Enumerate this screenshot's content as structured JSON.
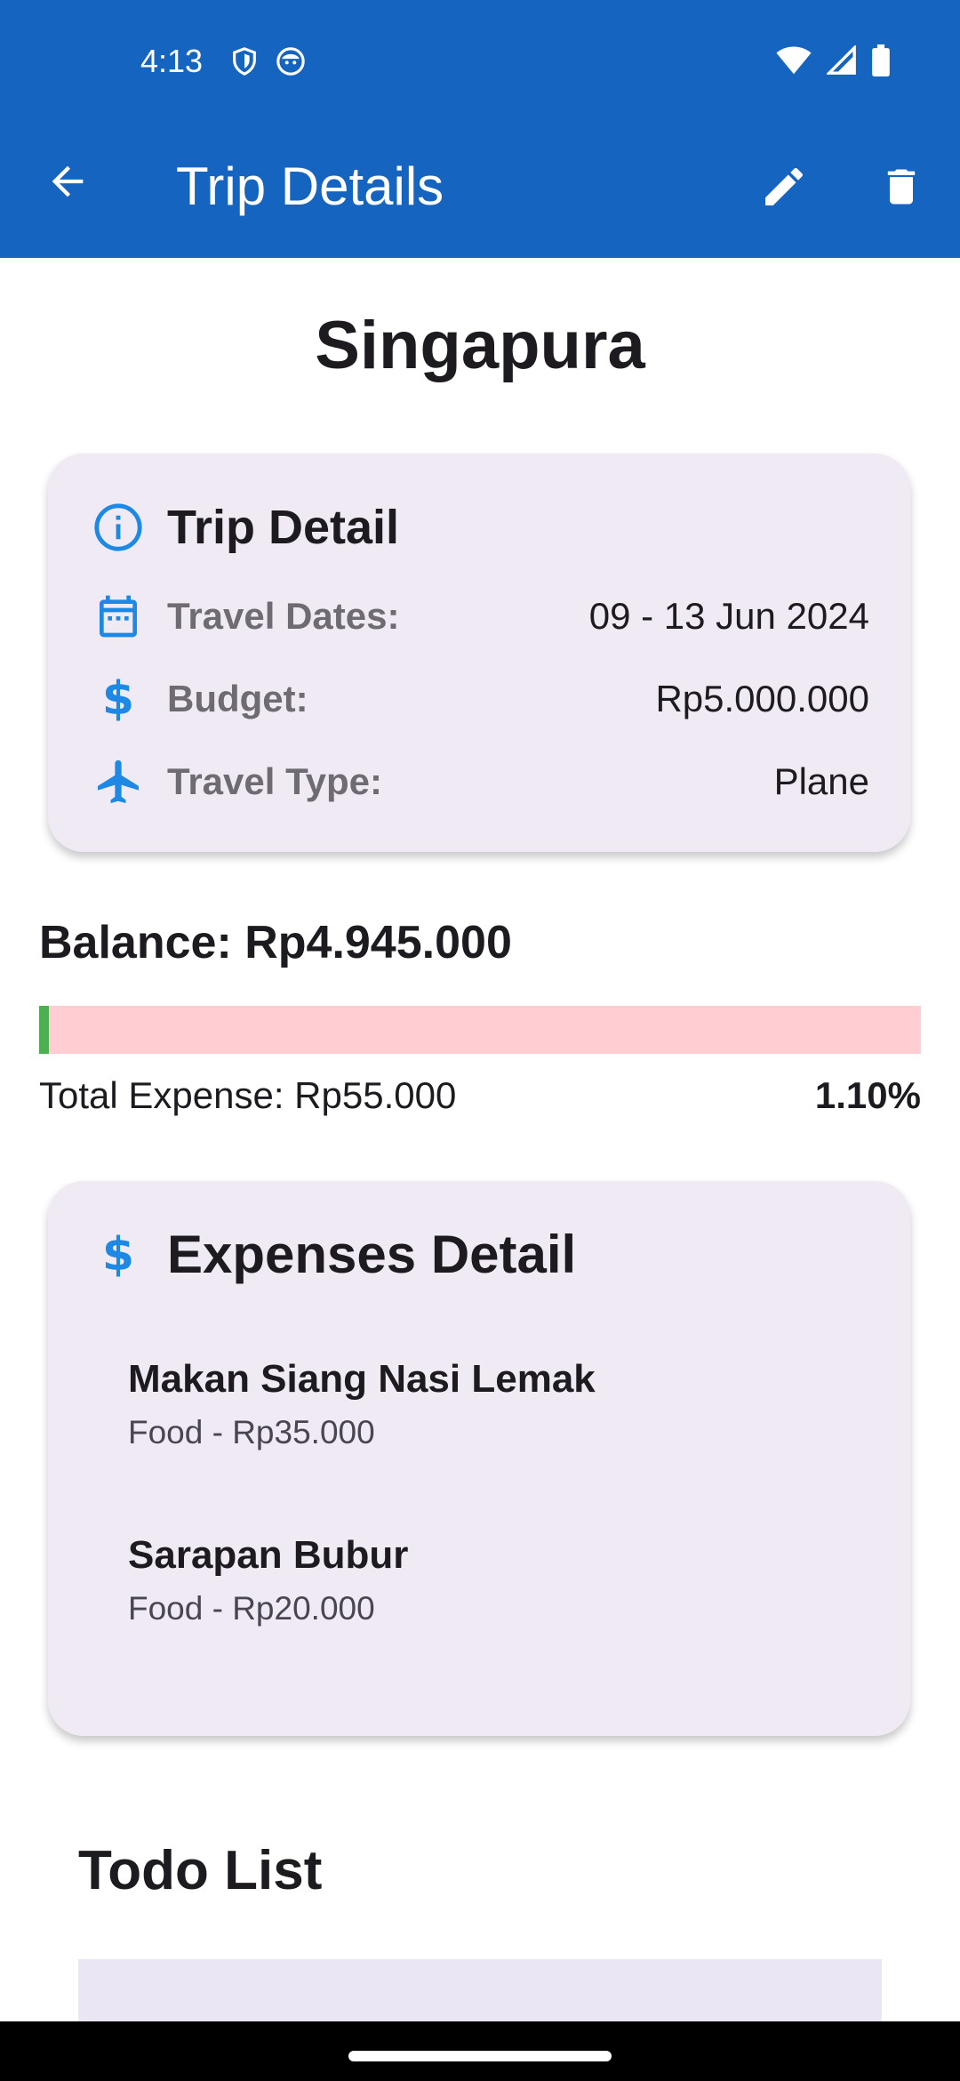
{
  "status_bar": {
    "time": "4:13",
    "left_icons": [
      "shield-icon",
      "face-icon"
    ],
    "right_icons": [
      "wifi-icon",
      "signal-icon",
      "battery-icon"
    ]
  },
  "app_bar": {
    "title": "Trip Details",
    "back_icon": "arrow-back-icon",
    "actions": [
      "edit-icon",
      "delete-icon"
    ],
    "color": "#1565c0"
  },
  "trip": {
    "name": "Singapura"
  },
  "trip_detail_card": {
    "heading": "Trip Detail",
    "rows": [
      {
        "icon": "calendar-icon",
        "label": "Travel Dates:",
        "value": "09 - 13 Jun 2024"
      },
      {
        "icon": "dollar-icon",
        "label": "Budget:",
        "value": "Rp5.000.000"
      },
      {
        "icon": "airplane-icon",
        "label": "Travel Type:",
        "value": "Plane"
      }
    ]
  },
  "balance": {
    "text": "Balance: Rp4.945.000",
    "progress_fraction": 0.011,
    "total_expense_text": "Total Expense: Rp55.000",
    "percent_text": "1.10%",
    "fill_color": "#4caf50",
    "track_color": "#ffcdd2"
  },
  "expenses_card": {
    "heading": "Expenses Detail",
    "items": [
      {
        "title": "Makan Siang Nasi Lemak",
        "subtitle": "Food - Rp35.000"
      },
      {
        "title": "Sarapan Bubur",
        "subtitle": "Food - Rp20.000"
      }
    ]
  },
  "todo": {
    "heading": "Todo List"
  }
}
